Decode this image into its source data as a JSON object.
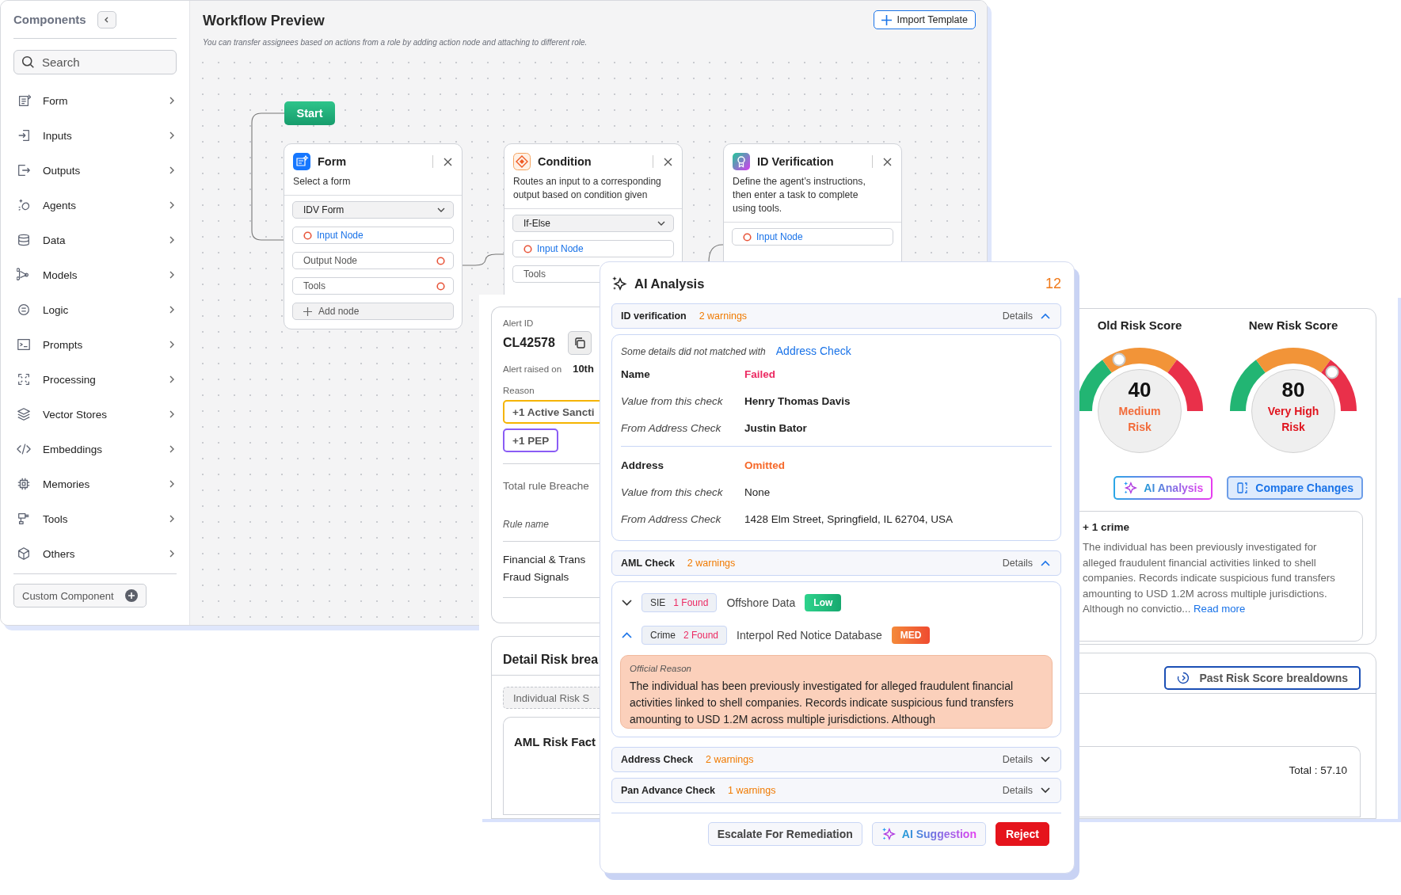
{
  "sidebar": {
    "title": "Components",
    "search": {
      "placeholder": "Search"
    },
    "items": [
      {
        "label": "Form"
      },
      {
        "label": "Inputs"
      },
      {
        "label": "Outputs"
      },
      {
        "label": "Agents"
      },
      {
        "label": "Data"
      },
      {
        "label": "Models"
      },
      {
        "label": "Logic"
      },
      {
        "label": "Prompts"
      },
      {
        "label": "Processing"
      },
      {
        "label": "Vector Stores"
      },
      {
        "label": "Embeddings"
      },
      {
        "label": "Memories"
      },
      {
        "label": "Tools"
      },
      {
        "label": "Others"
      }
    ],
    "custom_button": "Custom Component"
  },
  "workflow": {
    "title": "Workflow Preview",
    "subtitle": "You can transfer assignees based on actions from a role by adding action node and attaching to different role.",
    "import_button": "Import Template",
    "start_label": "Start",
    "nodes": [
      {
        "kind": "form",
        "title": "Form",
        "description": "Select a form",
        "select": "IDV Form",
        "ports": [
          {
            "kind": "input",
            "label": "Input Node"
          },
          {
            "kind": "output",
            "label": "Output Node"
          },
          {
            "kind": "output",
            "label": "Tools"
          }
        ],
        "add_label": "Add node"
      },
      {
        "kind": "condition",
        "title": "Condition",
        "description": "Routes an input to a corresponding output based on condition given",
        "select": "If-Else",
        "ports": [
          {
            "kind": "input",
            "label": "Input Node"
          },
          {
            "kind": "plain",
            "label": "Tools"
          }
        ]
      },
      {
        "kind": "verify",
        "title": "ID Verification",
        "description": "Define the agent’s instructions, then enter a task to complete using tools.",
        "ports": [
          {
            "kind": "input",
            "label": "Input Node"
          }
        ]
      }
    ]
  },
  "alert": {
    "id_label": "Alert ID",
    "id": "CL42578",
    "raised_label": "Alert raised on",
    "raised_value": "10th",
    "reason_label": "Reason",
    "reasons": [
      {
        "label": "+1 Active Sancti",
        "color": "#f5b400"
      },
      {
        "label": "+1 PEP",
        "color": "#8a5cf5"
      }
    ],
    "breaches_label": "Total rule Breache",
    "rule_label": "Rule name",
    "rule_lines": [
      "Financial & Trans",
      "Fraud Signals"
    ],
    "detail_title": "Detail Risk brea",
    "detail_tab": "Individual Risk S",
    "aml_title": "AML Risk Fact"
  },
  "risk_scores": [
    {
      "title": "Old Risk Score",
      "score": "40",
      "label_lines": [
        "Medium",
        "Risk"
      ],
      "color": "#f26b3a"
    },
    {
      "title": "New Risk Score",
      "score": "80",
      "label_lines": [
        "Very High",
        "Risk"
      ],
      "color": "#e0141e"
    }
  ],
  "risk_buttons": [
    {
      "kind": "ai",
      "label": "AI Analysis"
    },
    {
      "kind": "compare",
      "label": "Compare Changes"
    }
  ],
  "crime": {
    "title": "+ 1 crime",
    "text": "The individual has been previously investigated for alleged fraudulent financial activities linked to shell companies. Records indicate suspicious fund transfers amounting to USD 1.2M across multiple jurisdictions. Although no convictio...",
    "link": "Read more"
  },
  "past_button": "Past Risk Score brealdowns",
  "total": "Total : 57.10",
  "ai_panel": {
    "title": "AI Analysis",
    "count": "12",
    "sections": [
      {
        "kind": "fields",
        "name": "ID verification",
        "warnings": "2 warnings",
        "details": "Details",
        "expanded": true,
        "intro": "Some details did not matched with",
        "link": "Address Check",
        "groups": [
          {
            "label": "Name",
            "status": "Failed",
            "kind": "failed",
            "bold": true,
            "rows": [
              {
                "label": "Value from this check",
                "value": "Henry Thomas Davis"
              },
              {
                "label": "From Address Check",
                "value": "Justin Bator"
              }
            ]
          },
          {
            "label": "Address",
            "status": "Omitted",
            "kind": "omitted",
            "bold": false,
            "rows": [
              {
                "label": "Value from this check",
                "value": "None"
              },
              {
                "label": "From Address Check",
                "value": "1428 Elm Street, Springfield, IL 62704, USA"
              }
            ]
          }
        ]
      },
      {
        "kind": "matches",
        "name": "AML Check",
        "warnings": "2 warnings",
        "details": "Details",
        "expanded": true,
        "matches": [
          {
            "expanded": false,
            "source": "SIE",
            "count": "1 Found",
            "name": "Offshore Data",
            "tag": "Low",
            "kind": "low"
          },
          {
            "expanded": true,
            "source": "Crime",
            "count": "2 Found",
            "name": "Interpol Red Notice Database",
            "tag": "MED",
            "kind": "med",
            "reason_label": "Official Reason",
            "reason": "The individual has been previously investigated for alleged fraudulent financial activities linked to shell companies. Records indicate suspicious fund transfers amounting to USD 1.2M across multiple jurisdictions. Although"
          }
        ]
      },
      {
        "kind": "fields",
        "name": "Address Check",
        "warnings": "2 warnings",
        "details": "Details",
        "expanded": false
      },
      {
        "kind": "fields",
        "name": "Pan Advance Check",
        "warnings": "1 warnings",
        "details": "Details",
        "expanded": false
      }
    ],
    "buttons": [
      {
        "kind": "secondary",
        "label": "Escalate For Remediation"
      },
      {
        "kind": "ai",
        "label": "AI Suggestion"
      },
      {
        "kind": "danger",
        "label": "Reject"
      }
    ]
  }
}
